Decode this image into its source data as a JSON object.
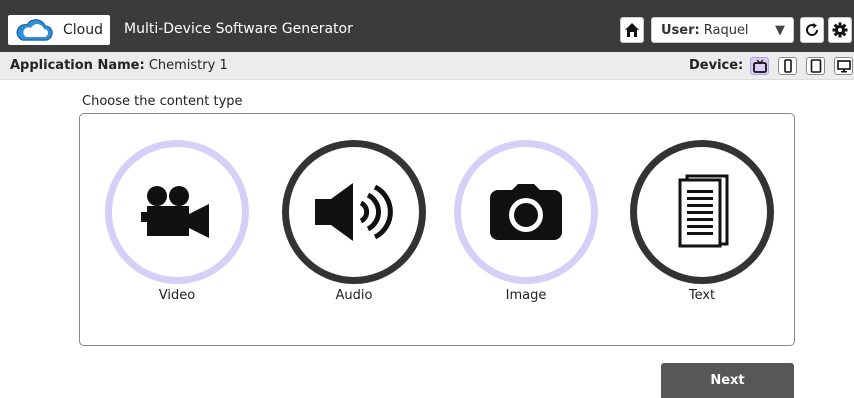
{
  "header": {
    "logo_text": "Cloud",
    "app_title": "Multi-Device Software Generator",
    "home_icon": "home-icon",
    "user_label": "User:",
    "user_value": "Raquel",
    "refresh_icon": "refresh-icon",
    "settings_icon": "gear-icon"
  },
  "subbar": {
    "app_name_label": "Application Name:",
    "app_name_value": "Chemistry 1",
    "device_label": "Device:",
    "devices": [
      {
        "name": "tv",
        "active": true
      },
      {
        "name": "phone",
        "active": false
      },
      {
        "name": "tablet",
        "active": false
      },
      {
        "name": "desktop",
        "active": false
      }
    ]
  },
  "main": {
    "prompt": "Choose the content type",
    "options": [
      {
        "label": "Video",
        "icon": "video-camera-icon",
        "selected": true
      },
      {
        "label": "Audio",
        "icon": "speaker-icon",
        "selected": false
      },
      {
        "label": "Image",
        "icon": "photo-camera-icon",
        "selected": true
      },
      {
        "label": "Text",
        "icon": "document-icon",
        "selected": false
      }
    ],
    "next_label": "Next"
  },
  "colors": {
    "topbar": "#3b3b3b",
    "accent_ring": "#d6cff7",
    "dark_ring": "#333333",
    "next_button": "#575757"
  }
}
